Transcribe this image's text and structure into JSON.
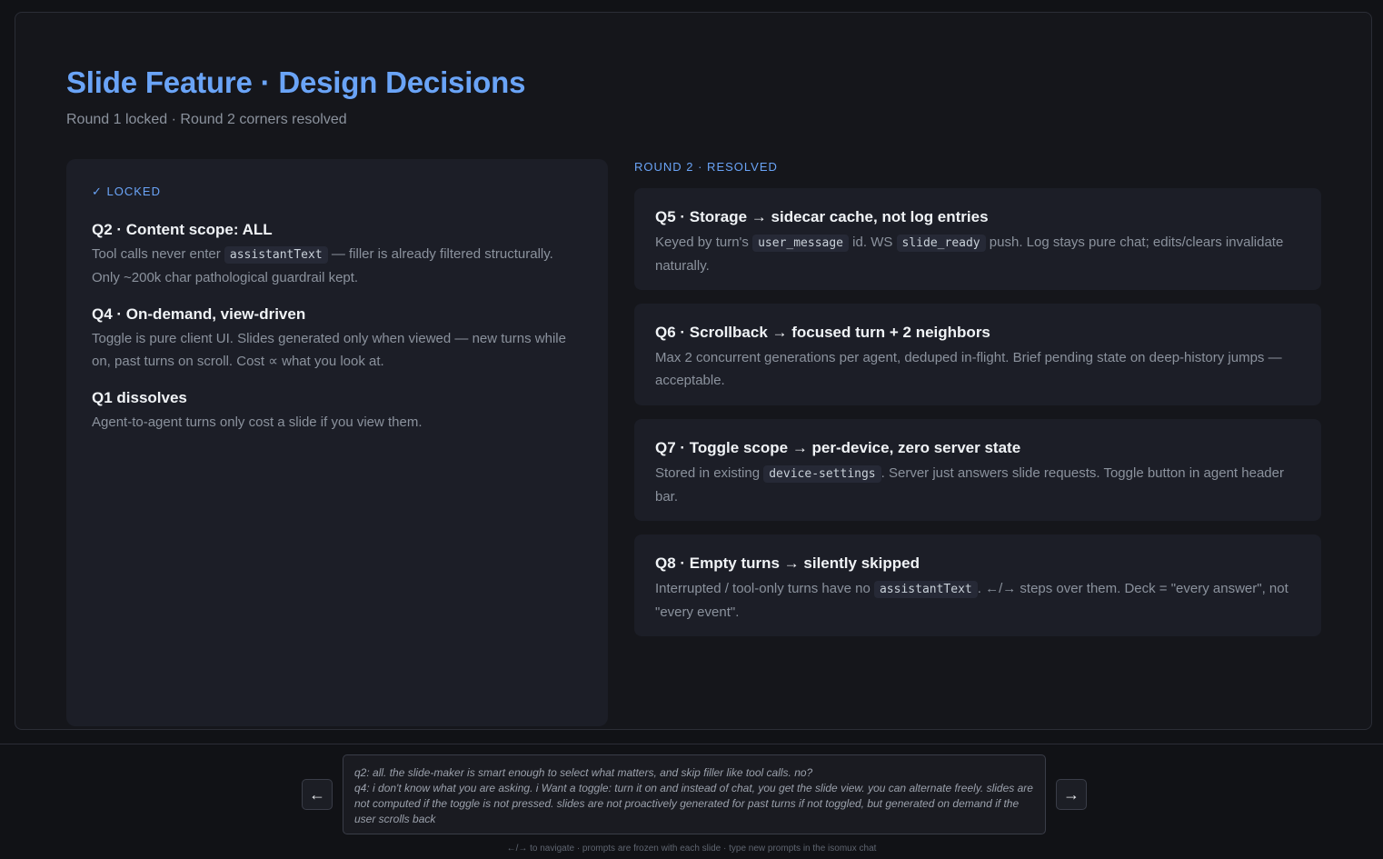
{
  "slide": {
    "title": "Slide Feature · Design Decisions",
    "subtitle": "Round 1 locked · Round 2 corners resolved",
    "locked": {
      "label": "✓ LOCKED",
      "items": [
        {
          "title": "Q2 · Content scope: ALL",
          "body_pre": "Tool calls never enter ",
          "code": "assistantText",
          "body_post": " — filler is already filtered structurally. Only ~200k char pathological guardrail kept."
        },
        {
          "title": "Q4 · On-demand, view-driven",
          "body": "Toggle is pure client UI. Slides generated only when viewed — new turns while on, past turns on scroll. Cost ∝ what you look at."
        },
        {
          "title": "Q1 dissolves",
          "body": "Agent-to-agent turns only cost a slide if you view them."
        }
      ]
    },
    "resolved": {
      "label": "ROUND 2 · RESOLVED",
      "cards": [
        {
          "title": "Q5 · Storage → sidecar cache, not log entries",
          "p1": "Keyed by turn's ",
          "c1": "user_message",
          "p2": " id. WS ",
          "c2": "slide_ready",
          "p3": " push. Log stays pure chat; edits/clears invalidate naturally."
        },
        {
          "title": "Q6 · Scrollback → focused turn + 2 neighbors",
          "body": "Max 2 concurrent generations per agent, deduped in-flight. Brief pending state on deep-history jumps — acceptable."
        },
        {
          "title": "Q7 · Toggle scope → per-device, zero server state",
          "p1": "Stored in existing ",
          "c1": "device-settings",
          "p2": ". Server just answers slide requests. Toggle button in agent header bar."
        },
        {
          "title": "Q8 · Empty turns → silently skipped",
          "p1": "Interrupted / tool-only turns have no ",
          "c1": "assistantText",
          "p2": ". ←/→ steps over them. Deck = \"every answer\", not \"every event\"."
        }
      ]
    }
  },
  "nav": {
    "prev_label": "←",
    "next_label": "→"
  },
  "prompt": {
    "line1": "q2: all. the slide-maker is smart enough to select what matters, and skip filler like tool calls. no?",
    "line2": "q4: i don't know what you are asking. i Want a toggle: turn it on and instead of chat, you get the slide view. you can alternate freely. slides are not computed if the toggle is not pressed. slides are not proactively generated for past turns if not toggled, but generated on demand if the user scrolls back"
  },
  "footer": {
    "hint": "←/→ to navigate · prompts are frozen with each slide · type new prompts in the isomux chat"
  }
}
